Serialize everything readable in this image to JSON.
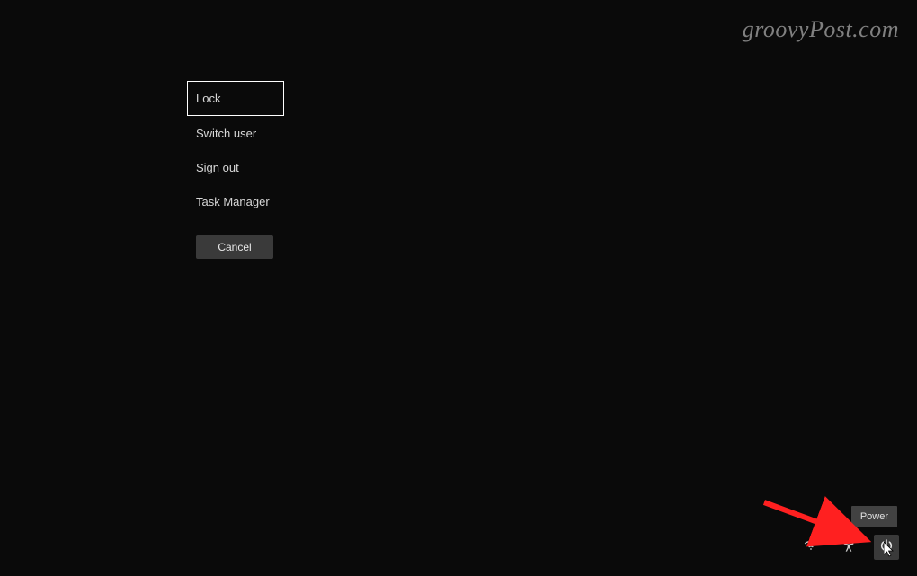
{
  "watermark": "groovyPost.com",
  "menu": {
    "items": [
      {
        "label": "Lock",
        "selected": true
      },
      {
        "label": "Switch user",
        "selected": false
      },
      {
        "label": "Sign out",
        "selected": false
      },
      {
        "label": "Task Manager",
        "selected": false
      }
    ],
    "cancel": "Cancel"
  },
  "tooltip": "Power",
  "icons": {
    "wifi": "wifi-icon",
    "accessibility": "accessibility-icon",
    "power": "power-icon"
  }
}
